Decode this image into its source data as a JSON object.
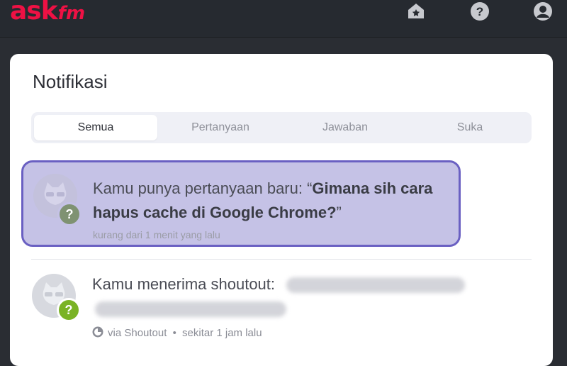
{
  "app": {
    "logo_main": "ASK",
    "logo_sub": "fm"
  },
  "header": {
    "icons": [
      "notifications-home-icon",
      "help-icon",
      "profile-icon"
    ]
  },
  "page": {
    "title": "Notifikasi"
  },
  "tabs": [
    {
      "label": "Semua",
      "active": true
    },
    {
      "label": "Pertanyaan",
      "active": false
    },
    {
      "label": "Jawaban",
      "active": false
    },
    {
      "label": "Suka",
      "active": false
    }
  ],
  "notifications": [
    {
      "text_prefix": "Kamu punya pertanyaan baru: “",
      "text_bold": "Gimana sih cara hapus cache di Google Chrome?",
      "text_suffix": "”",
      "time": "kurang dari 1 menit yang lalu",
      "highlighted": true,
      "badge": "?"
    },
    {
      "text_prefix": "Kamu menerima shoutout:",
      "time": "sekitar 1 jam lalu",
      "via": "via Shoutout",
      "separator": "•",
      "highlighted": false,
      "badge": "?"
    }
  ],
  "colors": {
    "brand": "#ee1144",
    "highlight_bg": "#c5c2e6",
    "highlight_border": "#6a60c2",
    "badge_gray": "#7f9272",
    "badge_green": "#7ab325"
  }
}
